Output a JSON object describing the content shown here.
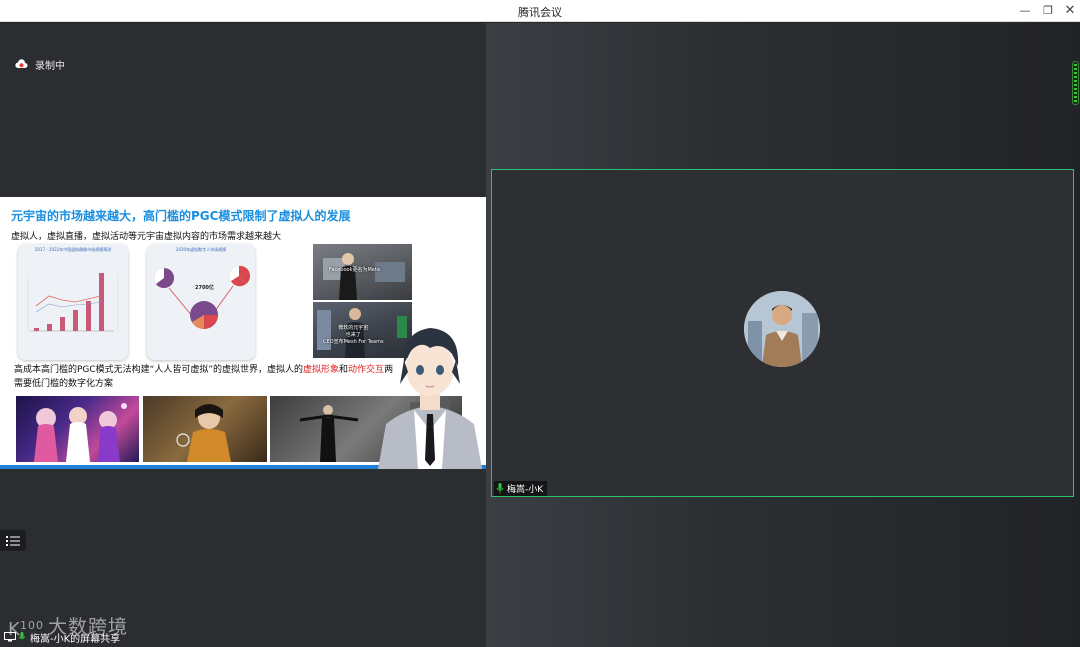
{
  "window": {
    "title": "腾讯会议",
    "minimize_glyph": "—",
    "restore_glyph": "❐",
    "close_glyph": "✕"
  },
  "recording": {
    "label": "录制中",
    "icon": "cloud-record-icon"
  },
  "slide": {
    "title": "元宇宙的市场越来越大，高门槛的PGC模式限制了虚拟人的发展",
    "subtitle": "虚拟人，虚拟直播，虚拟活动等元宇宙虚拟内容的市场需求越来越大",
    "chart1": {
      "title": "2017 - 2022年中国虚拟偶像市场规模预测"
    },
    "chart2": {
      "title": "2030年虚拟数字人市场规模",
      "center_value": "2700亿"
    },
    "photo1_caption": "Facebook更名为Meta",
    "photo2_caption_line1": "微软的元宇宙",
    "photo2_caption_line2": "也来了",
    "photo2_caption_line3": "CEO宣布Mesh For Teams",
    "paragraph_pre": "高成本高门槛的PGC模式无法构建“人人皆可虚拟”的虚拟世界，虚拟人的",
    "paragraph_red1": "虚拟形象",
    "paragraph_mid": "和",
    "paragraph_red2": "动作交互",
    "paragraph_post": "两",
    "paragraph_line2": "需要低门槛的数字化方案"
  },
  "screen_share": {
    "label": "梅嵩-小K的屏幕共享"
  },
  "watermark": {
    "text": "大数跨境"
  },
  "participant": {
    "name": "梅嵩-小K",
    "mic_icon": "mic-icon"
  },
  "colors": {
    "accent_green": "#2ec06a",
    "slide_title": "#1a8fe0",
    "highlight_red": "#e02020"
  }
}
